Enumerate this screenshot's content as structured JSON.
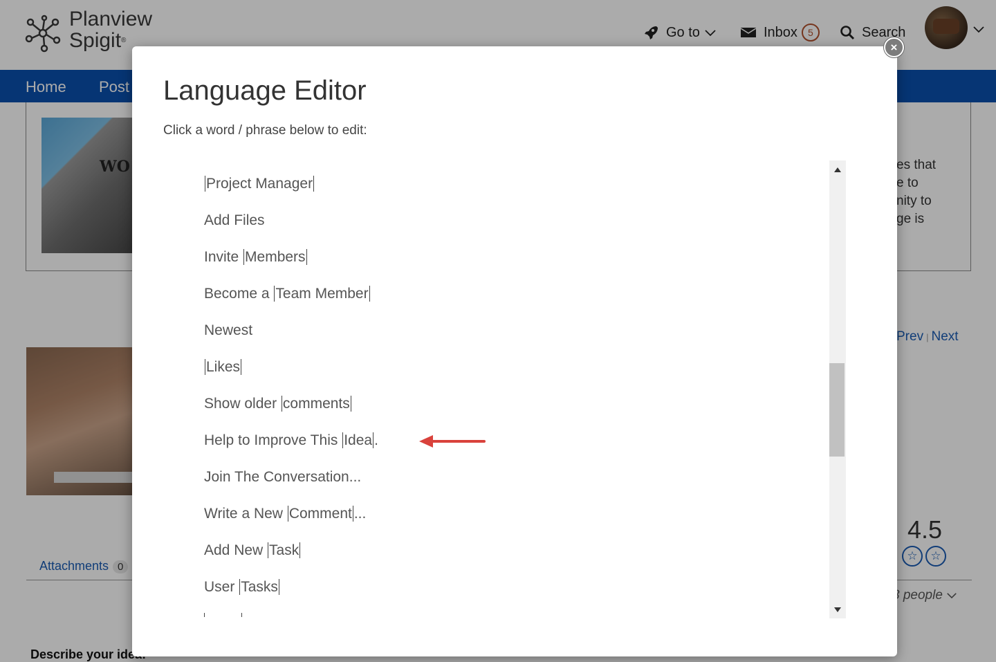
{
  "header": {
    "logo_line1": "Planview",
    "logo_line2": "Spigit",
    "goto_label": "Go to",
    "inbox_label": "Inbox",
    "inbox_count": "5",
    "search_label": "Search"
  },
  "nav": {
    "items": [
      {
        "label": "Home"
      },
      {
        "label": "Post"
      }
    ]
  },
  "background": {
    "gear_word": "WO",
    "side_text": [
      "es that",
      "e to",
      "nity to",
      "ge is"
    ],
    "prev_label": "Prev",
    "sep": "|",
    "next_label": "Next",
    "rating": "4.5",
    "people_label": "3 people",
    "attachments_label": "Attachments",
    "attachments_count": "0",
    "describe_label": "Describe your idea:"
  },
  "modal": {
    "title": "Language Editor",
    "subtitle": "Click a word / phrase below to edit:",
    "close_label": "×",
    "phrases": [
      [
        {
          "t": "Project Manager",
          "tok": true
        }
      ],
      [
        {
          "t": "Add Files",
          "tok": false
        }
      ],
      [
        {
          "t": "Invite ",
          "tok": false
        },
        {
          "t": "Members",
          "tok": true
        }
      ],
      [
        {
          "t": "Become a ",
          "tok": false
        },
        {
          "t": "Team Member",
          "tok": true
        }
      ],
      [
        {
          "t": "Newest",
          "tok": false
        }
      ],
      [
        {
          "t": "Likes",
          "tok": true
        }
      ],
      [
        {
          "t": "Show older ",
          "tok": false
        },
        {
          "t": "comments",
          "tok": true
        }
      ],
      [
        {
          "t": "Help to Improve This ",
          "tok": false
        },
        {
          "t": "Idea",
          "tok": true
        },
        {
          "t": ".",
          "tok": false
        }
      ],
      [
        {
          "t": "Join The Conversation...",
          "tok": false
        }
      ],
      [
        {
          "t": "Write a New ",
          "tok": false
        },
        {
          "t": "Comment",
          "tok": true
        },
        {
          "t": "...",
          "tok": false
        }
      ],
      [
        {
          "t": "Add New ",
          "tok": false
        },
        {
          "t": "Task",
          "tok": true
        }
      ],
      [
        {
          "t": "User ",
          "tok": false
        },
        {
          "t": "Tasks",
          "tok": true
        }
      ]
    ]
  },
  "colors": {
    "nav_bg": "#0a4fae",
    "link": "#1a5cb4",
    "arrow": "#d9423c",
    "badge": "#b0502c"
  }
}
